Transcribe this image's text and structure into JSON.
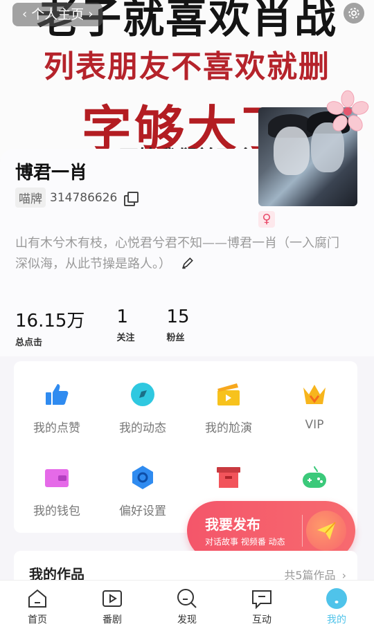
{
  "banner": {
    "line1": "老子就喜欢肖战",
    "line2": "列表朋友不喜欢就删",
    "line3": "字够大了",
    "line4": "不管我们并不会",
    "back_label": "个人主页"
  },
  "profile": {
    "name": "博君一肖",
    "id_tag": "喵牌",
    "id_number": "314786626",
    "gender_symbol": "♀",
    "bio": "山有木兮木有枝，心悦君兮君不知——博君一肖（一入腐门深似海，从此节操是路人。）"
  },
  "stats": [
    {
      "value": "16.15万",
      "label": "总点击"
    },
    {
      "value": "1",
      "label": "关注"
    },
    {
      "value": "15",
      "label": "粉丝"
    }
  ],
  "features": [
    {
      "label": "我的点赞",
      "icon": "thumbs-up-icon",
      "color": "#2f8bf0"
    },
    {
      "label": "我的动态",
      "icon": "compass-icon",
      "color": "#2fc8e0"
    },
    {
      "label": "我的尬演",
      "icon": "clapperboard-icon",
      "color": "#f7c21d"
    },
    {
      "label": "VIP",
      "icon": "crown-icon",
      "color": "#f7b51d"
    },
    {
      "label": "我的钱包",
      "icon": "wallet-icon",
      "color": "#e56ae8"
    },
    {
      "label": "偏好设置",
      "icon": "hexagon-settings-icon",
      "color": "#2f8bf0"
    },
    {
      "label": "",
      "icon": "archive-box-icon",
      "color": "#f2545b"
    },
    {
      "label": "",
      "icon": "gamepad-icon",
      "color": "#3bc97a"
    }
  ],
  "publish": {
    "title": "我要发布",
    "subtitle": "对话故事 视频番 动态"
  },
  "works": {
    "title": "我的作品",
    "count": "共5篇作品"
  },
  "tabs": [
    {
      "label": "首页",
      "icon": "home-icon"
    },
    {
      "label": "番剧",
      "icon": "play-icon"
    },
    {
      "label": "发现",
      "icon": "search-icon"
    },
    {
      "label": "互动",
      "icon": "chat-icon"
    },
    {
      "label": "我的",
      "icon": "profile-icon"
    }
  ]
}
